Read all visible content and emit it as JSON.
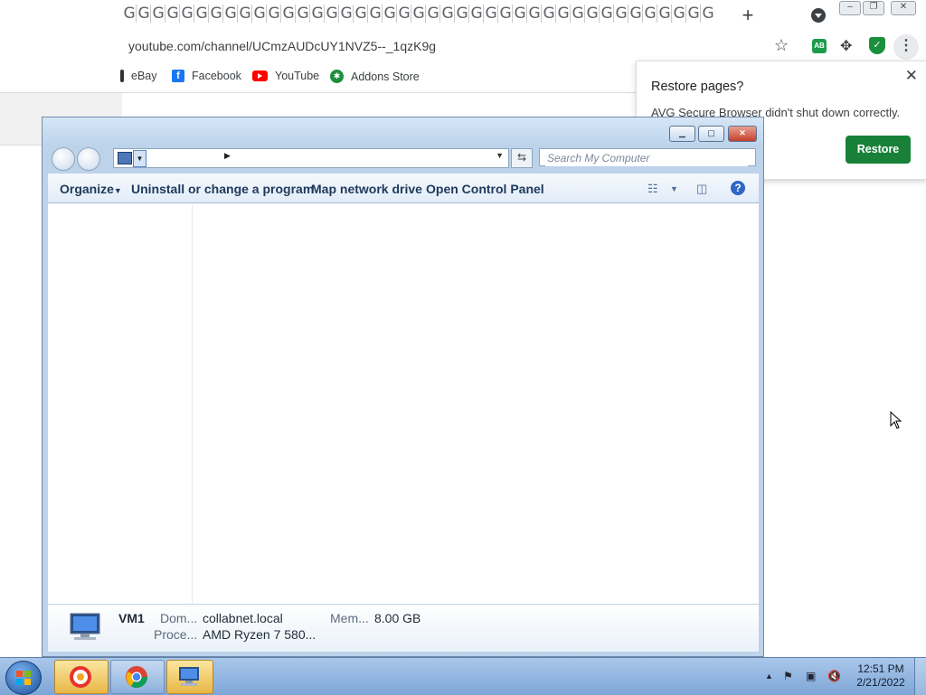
{
  "browser": {
    "tab_glyph": "G",
    "url": "youtube.com/channel/UCmzAUDcUY1NVZ5--_1qzK9g",
    "bookmarks": [
      {
        "label": "eBay"
      },
      {
        "label": "Facebook"
      },
      {
        "label": "YouTube"
      },
      {
        "label": "Addons Store"
      }
    ],
    "ext_ab": "AB"
  },
  "restore_popup": {
    "title": "Restore pages?",
    "message": "AVG Secure Browser didn't shut down correctly.",
    "button": "Restore"
  },
  "explorer": {
    "search_placeholder": "Search My Computer",
    "toolbar": {
      "organize": "Organize",
      "uninstall": "Uninstall or change a program",
      "map_drive": "Map network drive",
      "control_panel": "Open Control Panel"
    },
    "details": {
      "name": "VM1",
      "domain_label": "Dom...",
      "domain_value": "collabnet.local",
      "memory_label": "Mem...",
      "memory_value": "8.00 GB",
      "processor_label": "Proce...",
      "processor_value": "AMD Ryzen 7 580..."
    }
  },
  "taskbar": {
    "time": "12:51 PM",
    "date": "2/21/2022"
  },
  "colors": {
    "restore_button": "#188038",
    "taskbar": "#7ea6d7",
    "youtube_red": "#ff0000",
    "facebook_blue": "#1877f2"
  }
}
